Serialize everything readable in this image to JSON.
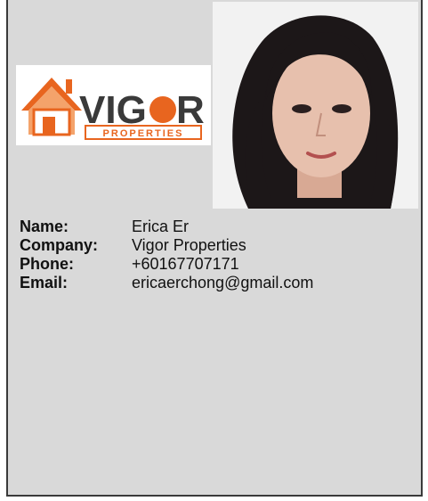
{
  "logo": {
    "brand": "VIGOR",
    "sub": "PROPERTIES"
  },
  "photo": {
    "description_icon": "profile-photo"
  },
  "details": {
    "name_label": "Name:",
    "name_value": "Erica Er",
    "company_label": "Company:",
    "company_value": "Vigor Properties",
    "phone_label": "Phone:",
    "phone_value": "+60167707171",
    "email_label": "Email:",
    "email_value": "ericaerchong@gmail.com"
  },
  "colors": {
    "card_bg": "#d9d9d9",
    "border": "#3a3a3a",
    "brand_orange": "#e8651f",
    "brand_gray": "#3a3a3a"
  }
}
